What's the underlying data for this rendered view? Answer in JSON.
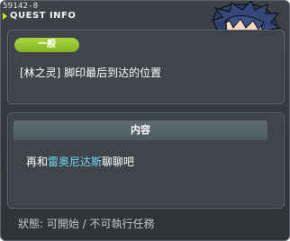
{
  "window": {
    "quest_id": "59142-0",
    "title": "QUEST INFO"
  },
  "quest": {
    "category_badge": "一般",
    "name": "[林之灵] 脚印最后到达的位置"
  },
  "content": {
    "header": "内容",
    "text_before": "再和",
    "npc_name": "雷奥尼达斯",
    "text_after": "聊聊吧"
  },
  "footer": {
    "status": "狀態: 可開始 / 不可執行任務"
  },
  "colors": {
    "badge_green": "#96c72c",
    "npc_highlight": "#6fd9f2",
    "panel_bg": "#40454c"
  }
}
